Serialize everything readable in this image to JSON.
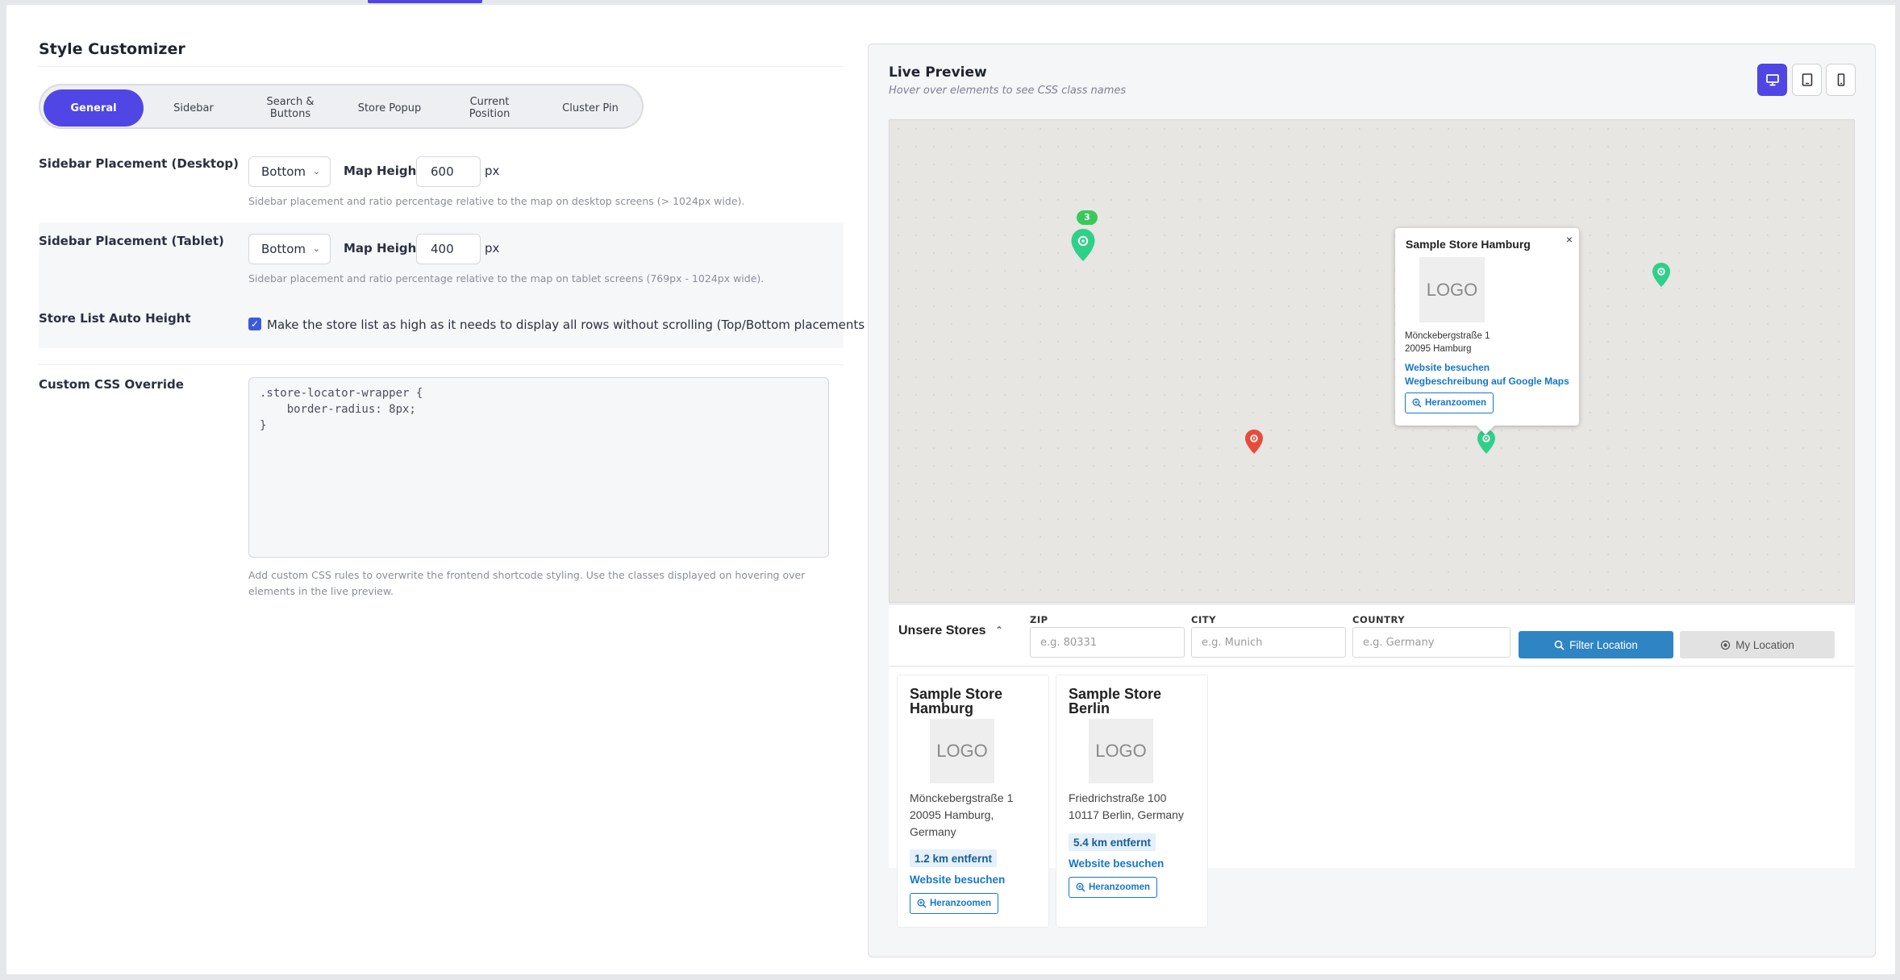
{
  "customizer": {
    "title": "Style Customizer",
    "tabs": [
      {
        "label": "General"
      },
      {
        "label": "Sidebar"
      },
      {
        "label": "Search &\nButtons"
      },
      {
        "label": "Store Popup"
      },
      {
        "label": "Current\nPosition"
      },
      {
        "label": "Cluster Pin"
      }
    ],
    "sidebar_desktop": {
      "label": "Sidebar Placement (Desktop)",
      "placement": "Bottom",
      "map_height_label": "Map Height:",
      "map_height": "600",
      "unit": "px",
      "hint": "Sidebar placement and ratio percentage relative to the map on desktop screens (> 1024px wide)."
    },
    "sidebar_tablet": {
      "label": "Sidebar Placement (Tablet)",
      "placement": "Bottom",
      "map_height_label": "Map Height:",
      "map_height": "400",
      "unit": "px",
      "hint": "Sidebar placement and ratio percentage relative to the map on tablet screens (769px - 1024px wide)."
    },
    "auto_height": {
      "label": "Store List Auto Height",
      "checked": true,
      "text": "Make the store list as high as it needs to display all rows without scrolling (Top/Bottom placements only)."
    },
    "custom_css": {
      "label": "Custom CSS Override",
      "value": ".store-locator-wrapper {\n    border-radius: 8px;\n}",
      "hint": "Add custom CSS rules to overwrite the frontend shortcode styling. Use the classes displayed on hovering over elements in the live preview."
    }
  },
  "preview": {
    "title": "Live Preview",
    "subtitle": "Hover over elements to see CSS class names",
    "devices": [
      "desktop-icon",
      "tablet-icon",
      "mobile-icon"
    ],
    "cluster_count": "3",
    "popup": {
      "title": "Sample Store Hamburg",
      "close": "×",
      "logo": "LOGO",
      "address_line1": "Mönckebergstraße 1",
      "address_line2": "20095 Hamburg",
      "link_website": "Website besuchen",
      "link_directions": "Wegbeschreibung auf Google Maps",
      "zoom": "Heranzoomen"
    },
    "search": {
      "title": "Unsere Stores",
      "zip_label": "ZIP",
      "zip_placeholder": "e.g. 80331",
      "city_label": "CITY",
      "city_placeholder": "e.g. Munich",
      "country_label": "COUNTRY",
      "country_placeholder": "e.g. Germany",
      "filter_button": "Filter Location",
      "location_button": "My Location"
    },
    "stores": [
      {
        "name": "Sample Store Hamburg",
        "logo": "LOGO",
        "address": "Mönckebergstraße 1\n20095 Hamburg,\nGermany",
        "distance": "1.2 km entfernt",
        "link": "Website besuchen",
        "zoom": "Heranzoomen"
      },
      {
        "name": "Sample Store Berlin",
        "logo": "LOGO",
        "address": "Friedrichstraße 100\n10117 Berlin, Germany",
        "distance": "5.4 km entfernt",
        "link": "Website besuchen",
        "zoom": "Heranzoomen"
      }
    ],
    "colors": {
      "accent": "#4f46e5",
      "pin_green": "#2fd08a",
      "pin_red": "#e84b3c",
      "link_blue": "#1677c9"
    }
  }
}
